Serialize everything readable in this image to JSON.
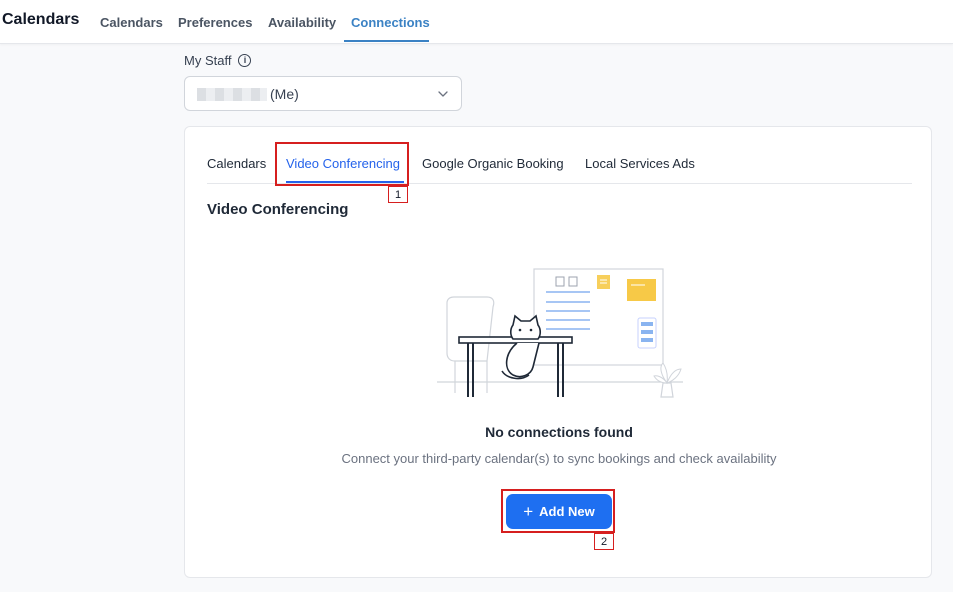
{
  "header": {
    "title": "Calendars",
    "nav": [
      "Calendars",
      "Preferences",
      "Availability",
      "Connections"
    ],
    "active_nav": "Connections"
  },
  "staff": {
    "label": "My Staff",
    "selected_suffix": "(Me)",
    "info_icon": "info-icon"
  },
  "card": {
    "tabs": [
      "Calendars",
      "Video Conferencing",
      "Google Organic Booking",
      "Local Services Ads"
    ],
    "active_tab": "Video Conferencing",
    "section_title": "Video Conferencing",
    "empty_title": "No connections found",
    "empty_desc": "Connect your third-party calendar(s) to sync bookings and check availability",
    "add_button": "Add New",
    "add_icon": "plus-icon"
  },
  "annotations": {
    "marker1": "1",
    "marker2": "2"
  },
  "colors": {
    "accent": "#3b82c4",
    "active_tab": "#2563eb",
    "button": "#1e6ff1",
    "annotation": "#d61f1f"
  }
}
